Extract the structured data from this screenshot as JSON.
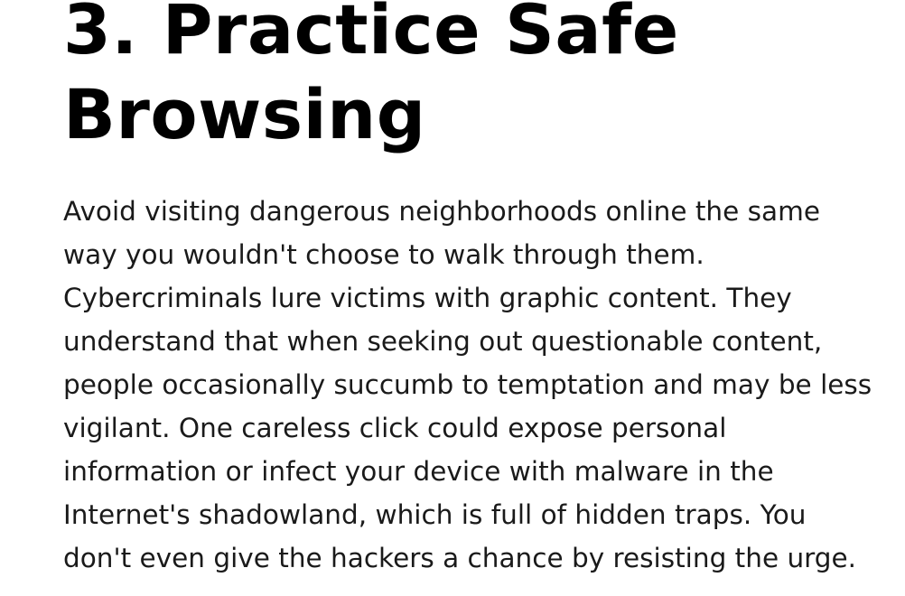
{
  "article": {
    "heading_lines": [
      "3. Practice Safe",
      "Browsing"
    ],
    "paragraph_lines": [
      "Avoid visiting dangerous neighborhoods online the same",
      "way you wouldn't choose to walk through them.",
      "Cybercriminals lure victims with graphic content. They",
      "understand that when seeking out questionable content,",
      "people occasionally succumb to temptation and may be less",
      "vigilant. One careless click could expose personal",
      "information or infect your device with malware in the",
      "Internet's shadowland, which is full of hidden traps. You",
      "don't even give the hackers a chance by resisting the urge."
    ]
  }
}
